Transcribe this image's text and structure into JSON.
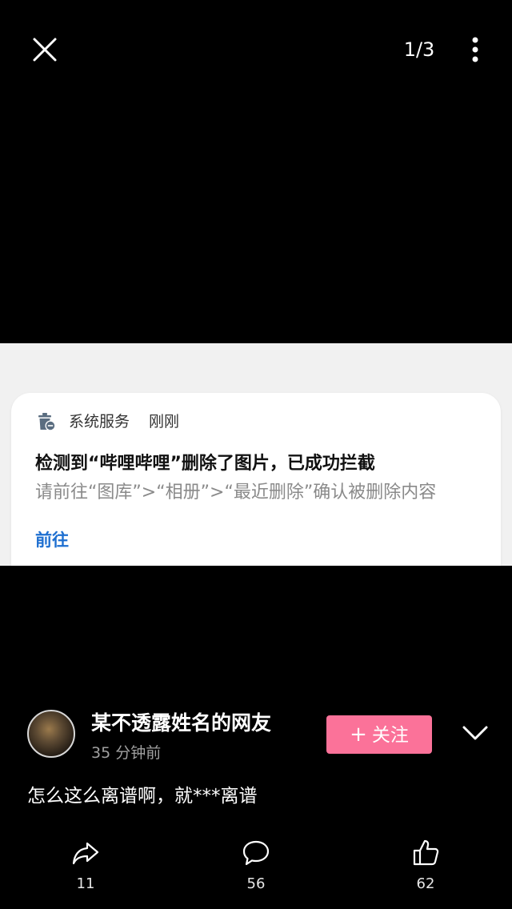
{
  "topbar": {
    "counter": "1/3",
    "close_icon": "close-icon",
    "more_icon": "more-vertical-icon"
  },
  "notification": {
    "app_icon": "trash-restore-icon",
    "app_name": "系统服务",
    "time": "刚刚",
    "title": "检测到“哔哩哔哩”删除了图片，已成功拦截",
    "body": "请前往“图库”>“相册”>“最近删除”确认被删除内容",
    "action": "前往",
    "action_color": "#1e6fd0"
  },
  "post": {
    "avatar_icon": "avatar",
    "username": "某不透露姓名的网友",
    "time": "35 分钟前",
    "follow_label": "关注",
    "follow_color": "#fb7299",
    "comment": "怎么这么离谱啊，就***离谱"
  },
  "actions": {
    "share": {
      "icon": "share-icon",
      "count": "11"
    },
    "comment": {
      "icon": "comment-icon",
      "count": "56"
    },
    "like": {
      "icon": "thumbs-up-icon",
      "count": "62"
    }
  }
}
